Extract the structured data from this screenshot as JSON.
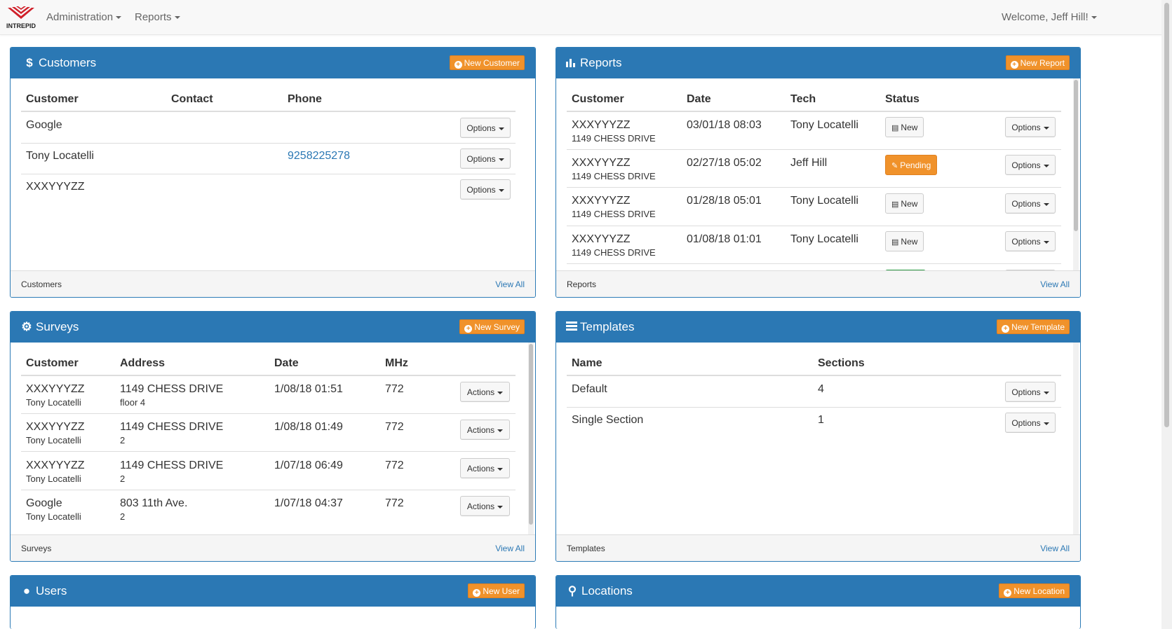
{
  "nav": {
    "logo_text": "INTREPID",
    "items": [
      {
        "label": "Administration"
      },
      {
        "label": "Reports"
      }
    ],
    "welcome": "Welcome, Jeff Hill!"
  },
  "colors": {
    "primary": "#2b78b4",
    "accent": "#f0922b",
    "success": "#2eaa4a"
  },
  "customers": {
    "title": "Customers",
    "icon": "dollar-icon",
    "new_button": "New Customer",
    "headers": [
      "Customer",
      "Contact",
      "Phone"
    ],
    "rows": [
      {
        "customer": "Google",
        "contact": "",
        "phone": "",
        "action": "Options"
      },
      {
        "customer": "Tony Locatelli",
        "contact": "",
        "phone": "9258225278",
        "action": "Options"
      },
      {
        "customer": "XXXYYYZZ",
        "contact": "",
        "phone": "",
        "action": "Options"
      }
    ],
    "footer": "Customers",
    "view_all": "View All"
  },
  "reports": {
    "title": "Reports",
    "icon": "bar-chart-icon",
    "new_button": "New Report",
    "headers": [
      "Customer",
      "Date",
      "Tech",
      "Status"
    ],
    "rows": [
      {
        "customer": "XXXYYYZZ",
        "address": "1149 CHESS DRIVE",
        "date": "03/01/18 08:03",
        "tech": "Tony Locatelli",
        "status": "New",
        "action": "Options"
      },
      {
        "customer": "XXXYYYZZ",
        "address": "1149 CHESS DRIVE",
        "date": "02/27/18 05:02",
        "tech": "Jeff Hill",
        "status": "Pending",
        "action": "Options"
      },
      {
        "customer": "XXXYYYZZ",
        "address": "1149 CHESS DRIVE",
        "date": "01/28/18 05:01",
        "tech": "Tony Locatelli",
        "status": "New",
        "action": "Options"
      },
      {
        "customer": "XXXYYYZZ",
        "address": "1149 CHESS DRIVE",
        "date": "01/08/18 01:01",
        "tech": "Tony Locatelli",
        "status": "New",
        "action": "Options"
      }
    ],
    "footer": "Reports",
    "view_all": "View All"
  },
  "surveys": {
    "title": "Surveys",
    "icon": "gear-icon",
    "new_button": "New Survey",
    "headers": [
      "Customer",
      "Address",
      "Date",
      "MHz"
    ],
    "rows": [
      {
        "customer": "XXXYYYZZ",
        "contact": "Tony Locatelli",
        "address": "1149 CHESS DRIVE",
        "address2": "floor 4",
        "date": "1/08/18 01:51",
        "mhz": "772",
        "action": "Actions"
      },
      {
        "customer": "XXXYYYZZ",
        "contact": "Tony Locatelli",
        "address": "1149 CHESS DRIVE",
        "address2": "2",
        "date": "1/08/18 01:49",
        "mhz": "772",
        "action": "Actions"
      },
      {
        "customer": "XXXYYYZZ",
        "contact": "Tony Locatelli",
        "address": "1149 CHESS DRIVE",
        "address2": "2",
        "date": "1/07/18 06:49",
        "mhz": "772",
        "action": "Actions"
      },
      {
        "customer": "Google",
        "contact": "Tony Locatelli",
        "address": "803 11th Ave.",
        "address2": "2",
        "date": "1/07/18 04:37",
        "mhz": "772",
        "action": "Actions"
      }
    ],
    "footer": "Surveys",
    "view_all": "View All"
  },
  "templates": {
    "title": "Templates",
    "icon": "list-icon",
    "new_button": "New Template",
    "headers": [
      "Name",
      "Sections"
    ],
    "rows": [
      {
        "name": "Default",
        "sections": "4",
        "action": "Options"
      },
      {
        "name": "Single Section",
        "sections": "1",
        "action": "Options"
      }
    ],
    "footer": "Templates",
    "view_all": "View All"
  },
  "users": {
    "title": "Users",
    "icon": "user-icon",
    "new_button": "New User"
  },
  "locations": {
    "title": "Locations",
    "icon": "map-marker-icon",
    "new_button": "New Location"
  }
}
